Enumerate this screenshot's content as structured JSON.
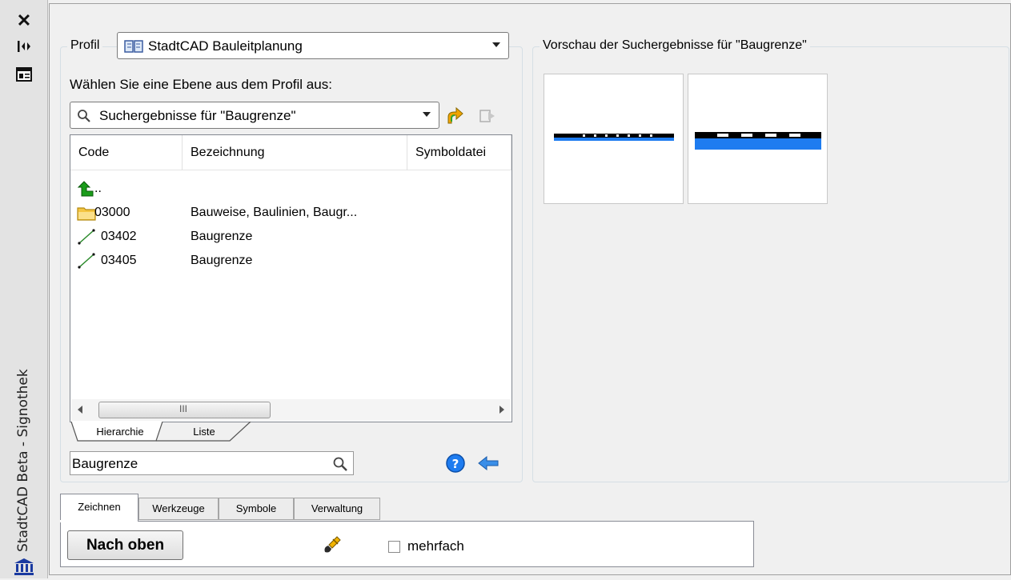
{
  "palette": {
    "title": "StadtCAD Beta - Signothek",
    "icons": [
      "close-icon",
      "auto-hide-icon",
      "properties-icon",
      "bank-icon"
    ]
  },
  "profile": {
    "label": "Profil",
    "selected": "StadtCAD Bauleitplanung",
    "layer_prompt": "Wählen Sie eine Ebene aus dem Profil aus:",
    "layer_selected": "Suchergebnisse für \"Baugrenze\""
  },
  "list": {
    "columns": [
      "Code",
      "Bezeichnung",
      "Symboldatei"
    ],
    "rows": [
      {
        "code": "..",
        "name": "",
        "icon": "up-arrow-icon"
      },
      {
        "code": "03000",
        "name": "Bauweise, Baulinien, Baugr...",
        "icon": "folder-icon"
      },
      {
        "code": "03402",
        "name": "Baugrenze",
        "icon": "line-icon"
      },
      {
        "code": "03405",
        "name": "Baugrenze",
        "icon": "line-icon"
      }
    ],
    "scroll_grip": "III"
  },
  "view_tabs": [
    "Hierarchie",
    "Liste"
  ],
  "search": {
    "value": "Baugrenze"
  },
  "preview": {
    "title": "Vorschau der Suchergebnisse für \"Baugrenze\""
  },
  "bottom_tabs": [
    "Zeichnen",
    "Werkzeuge",
    "Symbole",
    "Verwaltung"
  ],
  "draw": {
    "button": "Nach oben",
    "multiple_label": "mehrfach",
    "multiple_checked": false
  },
  "colors": {
    "accent_blue": "#1e7cf0",
    "folder": "#f5c542",
    "arrow_green": "#1a9c1a"
  }
}
